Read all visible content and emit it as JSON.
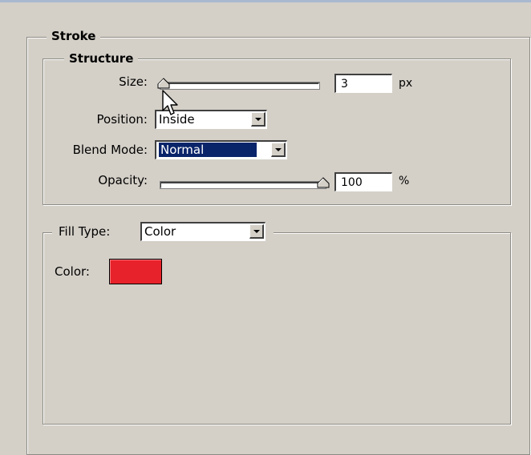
{
  "stroke": {
    "title": "Stroke",
    "structure": {
      "title": "Structure",
      "size": {
        "label": "Size:",
        "value": "3",
        "unit": "px",
        "slider_fraction": 0.0
      },
      "position": {
        "label": "Position:",
        "value": "Inside"
      },
      "blend_mode": {
        "label": "Blend Mode:",
        "value": "Normal"
      },
      "opacity": {
        "label": "Opacity:",
        "value": "100",
        "unit": "%",
        "slider_fraction": 1.0
      }
    },
    "fill": {
      "type_label": "Fill Type:",
      "type_value": "Color",
      "color_label": "Color:",
      "color_value": "#e8222a"
    }
  },
  "icons": {
    "cursor": "arrow-cursor-icon",
    "thumb": "slider-thumb-icon",
    "dropdown": "chevron-down-icon"
  }
}
